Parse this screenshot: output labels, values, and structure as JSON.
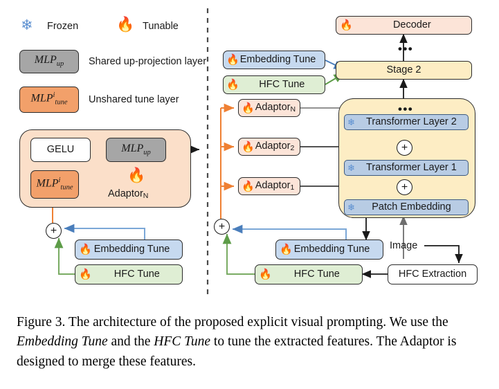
{
  "figure": {
    "caption_prefix": "Figure 3. The architecture of the proposed explicit visual prompting. We use the ",
    "caption_em1": "Embedding Tune",
    "caption_mid": " and the ",
    "caption_em2": "HFC Tune",
    "caption_suffix": " to tune the extracted features. The Adaptor is designed to merge these features."
  },
  "legend": {
    "frozen_icon": "snowflake-icon",
    "frozen_label": "Frozen",
    "tunable_icon": "flame-icon",
    "tunable_label": "Tunable",
    "mlp_up": {
      "base": "MLP",
      "sub": "up"
    },
    "mlp_up_desc": "Shared up-projection layer",
    "mlp_tune": {
      "base": "MLP",
      "sub": "tune",
      "sup": "i"
    },
    "mlp_tune_desc": "Unshared tune layer"
  },
  "left_panel": {
    "gelu": "GELU",
    "mlp_up": {
      "base": "MLP",
      "sub": "up"
    },
    "mlp_tune": {
      "base": "MLP",
      "sub": "tune",
      "sup": "i"
    },
    "adaptor_label": {
      "base": "Adaptor",
      "sub": "N"
    },
    "embedding_tune": "Embedding Tune",
    "hfc_tune": "HFC Tune",
    "plus": "+"
  },
  "right_panel": {
    "decoder": "Decoder",
    "stage2": "Stage 2",
    "embedding_tune_top": "Embedding Tune",
    "hfc_tune_top": "HFC Tune",
    "adaptors": [
      {
        "base": "Adaptor",
        "sub": "N"
      },
      {
        "base": "Adaptor",
        "sub": "2"
      },
      {
        "base": "Adaptor",
        "sub": "1"
      }
    ],
    "transformer_layer_2": "Transformer Layer 2",
    "transformer_layer_1": "Transformer Layer 1",
    "patch_embedding": "Patch Embedding",
    "embedding_tune_bottom": "Embedding Tune",
    "hfc_tune_bottom": "HFC Tune",
    "hfc_extraction": "HFC Extraction",
    "image_label": "Image",
    "ellipsis": "•••",
    "plus": "+"
  },
  "colors": {
    "peach_panel": "#fbdfc9",
    "peach_box": "#f2a06a",
    "pink_box": "#fce4d8",
    "gray_box": "#a6a6a6",
    "blue_box": "#c6d9ef",
    "green_box": "#dfeed4",
    "yellow_box": "#fdedc4",
    "blue_layer": "#b8cce4",
    "white_box": "#ffffff",
    "orange_line": "#ef8033",
    "blue_line": "#7ba7d7",
    "green_line": "#79ab63",
    "black_line": "#1a1a1a",
    "gray_line": "#6e6e6e"
  }
}
